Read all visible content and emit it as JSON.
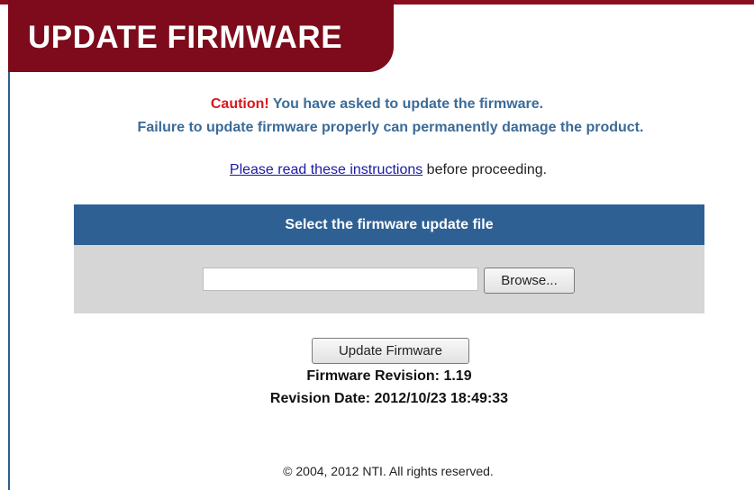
{
  "header": {
    "title": "UPDATE FIRMWARE"
  },
  "warning": {
    "caution_word": "Caution!",
    "caution_text": " You have asked to update the firmware.",
    "failure_text": "Failure to update firmware properly can permanently damage the product."
  },
  "instructions": {
    "link_text": "Please read these instructions",
    "trailing_text": " before proceeding."
  },
  "file_panel": {
    "header": "Select the firmware update file",
    "file_value": "",
    "browse_label": "Browse..."
  },
  "actions": {
    "update_label": "Update Firmware"
  },
  "firmware_info": {
    "revision": "Firmware Revision: 1.19",
    "date": "Revision Date: 2012/10/23 18:49:33"
  },
  "footer": {
    "copyright": "© 2004, 2012 NTI. All rights reserved."
  },
  "colors": {
    "brand_red": "#7e0b1b",
    "caution_red": "#d9171e",
    "text_blue": "#3b6b98",
    "panel_blue": "#2f6094",
    "panel_gray": "#d6d6d6",
    "link_blue": "#1a1aa6"
  }
}
